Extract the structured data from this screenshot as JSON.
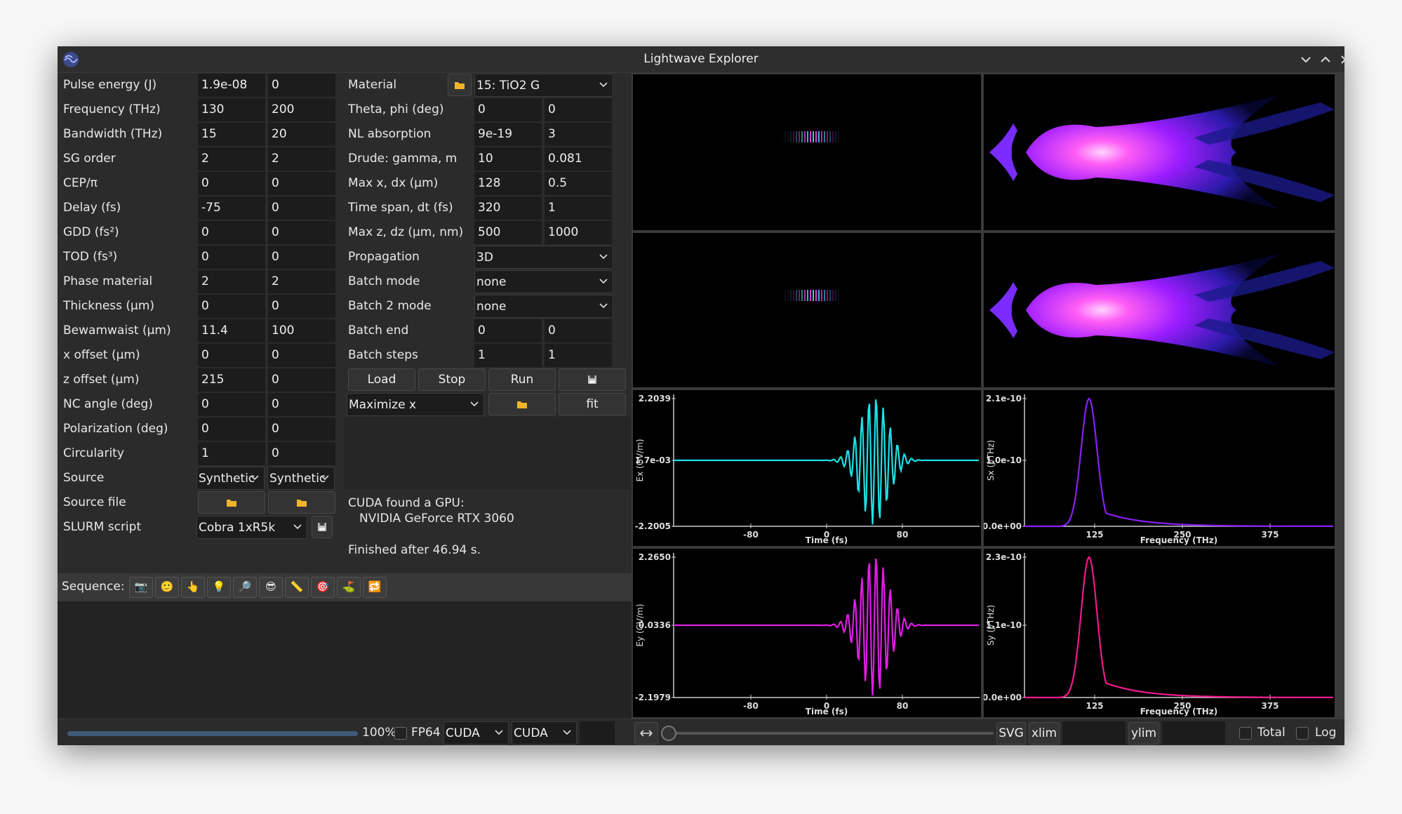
{
  "window": {
    "title": "Lightwave Explorer"
  },
  "left_params": [
    {
      "label": "Pulse energy (J)",
      "v1": "1.9e-08",
      "v2": "0"
    },
    {
      "label": "Frequency (THz)",
      "v1": "130",
      "v2": "200"
    },
    {
      "label": "Bandwidth (THz)",
      "v1": "15",
      "v2": "20"
    },
    {
      "label": "SG order",
      "v1": "2",
      "v2": "2"
    },
    {
      "label": "CEP/π",
      "v1": "0",
      "v2": "0"
    },
    {
      "label": "Delay (fs)",
      "v1": "-75",
      "v2": "0"
    },
    {
      "label": "GDD (fs²)",
      "v1": "0",
      "v2": "0"
    },
    {
      "label": "TOD (fs³)",
      "v1": "0",
      "v2": "0"
    },
    {
      "label": "Phase material",
      "v1": "2",
      "v2": "2"
    },
    {
      "label": "Thickness (μm)",
      "v1": "0",
      "v2": "0"
    },
    {
      "label": "Bewamwaist (μm)",
      "v1": "11.4",
      "v2": "100"
    },
    {
      "label": "x offset (μm)",
      "v1": "0",
      "v2": "0"
    },
    {
      "label": "z offset (μm)",
      "v1": "215",
      "v2": "0"
    },
    {
      "label": "NC angle (deg)",
      "v1": "0",
      "v2": "0"
    },
    {
      "label": "Polarization (deg)",
      "v1": "0",
      "v2": "0"
    },
    {
      "label": "Circularity",
      "v1": "1",
      "v2": "0"
    }
  ],
  "source": {
    "label": "Source",
    "sel1": "Synthetic",
    "sel2": "Synthetic"
  },
  "source_file": {
    "label": "Source file"
  },
  "slurm": {
    "label": "SLURM script",
    "value": "Cobra 1xR5k"
  },
  "material": {
    "label": "Material",
    "value": "15: TiO2 G"
  },
  "mid_params": [
    {
      "label": "Theta, phi (deg)",
      "v1": "0",
      "v2": "0"
    },
    {
      "label": "NL absorption",
      "v1": "9e-19",
      "v2": "3"
    },
    {
      "label": "Drude: gamma, m",
      "v1": "10",
      "v2": "0.081"
    },
    {
      "label": "Max x, dx (μm)",
      "v1": "128",
      "v2": "0.5"
    },
    {
      "label": "Time span, dt (fs)",
      "v1": "320",
      "v2": "1"
    },
    {
      "label": "Max z, dz (μm, nm)",
      "v1": "500",
      "v2": "1000"
    }
  ],
  "propagation": {
    "label": "Propagation",
    "value": "3D"
  },
  "batch_mode": {
    "label": "Batch mode",
    "value": "none"
  },
  "batch2_mode": {
    "label": "Batch 2 mode",
    "value": "none"
  },
  "batch_end": {
    "label": "Batch end",
    "v1": "0",
    "v2": "0"
  },
  "batch_steps": {
    "label": "Batch steps",
    "v1": "1",
    "v2": "1"
  },
  "buttons": {
    "load": "Load",
    "stop": "Stop",
    "run": "Run",
    "fit": "fit"
  },
  "fit_target": "Maximize x",
  "info": {
    "line1": "CUDA found a GPU:",
    "line2": "NVIDIA GeForce RTX 3060",
    "line3": "Finished after 46.94 s."
  },
  "sequence": {
    "label": "Sequence:"
  },
  "statusbar": {
    "progress_pct": "100%",
    "progress_value": 1.0,
    "fp64": "FP64",
    "cuda1": "CUDA",
    "cuda2": "CUDA",
    "svg": "SVG",
    "xlim": "xlim",
    "ylim": "ylim",
    "total": "Total",
    "log": "Log"
  },
  "plots": {
    "ex": {
      "ylabel": "Ex (GV/m)",
      "xlabel": "Time (fs)",
      "yticks": [
        "2.2039",
        "1.7e-03",
        "-2.2005"
      ],
      "xticks": [
        "-80",
        "0",
        "80"
      ],
      "color": "#1de1e8"
    },
    "ey": {
      "ylabel": "Ey (GV/m)",
      "xlabel": "Time (fs)",
      "yticks": [
        "2.2650",
        "0.0336",
        "-2.1979"
      ],
      "xticks": [
        "-80",
        "0",
        "80"
      ],
      "color": "#e01ee6"
    },
    "sx": {
      "ylabel": "Sx (J/THz)",
      "xlabel": "Frequency (THz)",
      "yticks": [
        "2.1e-10",
        "1.0e-10",
        "0.0e+00"
      ],
      "xticks": [
        "125",
        "250",
        "375"
      ],
      "color": "#8a1ff5"
    },
    "sy": {
      "ylabel": "Sy (J/THz)",
      "xlabel": "Frequency (THz)",
      "yticks": [
        "2.3e-10",
        "1.1e-10",
        "0.0e+00"
      ],
      "xticks": [
        "125",
        "250",
        "375"
      ],
      "color": "#f01a8c"
    }
  }
}
